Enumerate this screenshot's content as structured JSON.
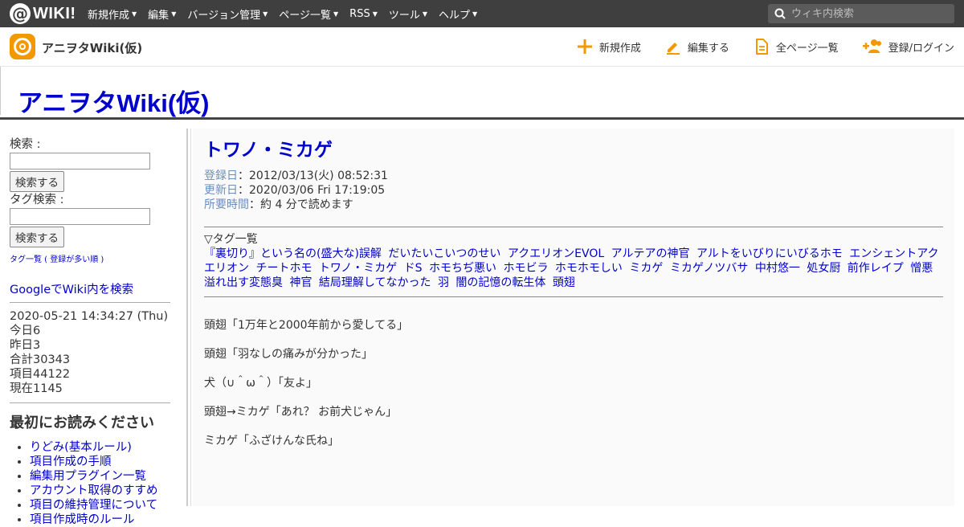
{
  "topbar": {
    "logo_at": "@",
    "logo_text": "WIKI!",
    "menu": [
      {
        "label": "新規作成"
      },
      {
        "label": "編集"
      },
      {
        "label": "バージョン管理"
      },
      {
        "label": "ページ一覧"
      },
      {
        "label": "RSS"
      },
      {
        "label": "ツール"
      },
      {
        "label": "ヘルプ"
      }
    ],
    "search_placeholder": "ウィキ内検索"
  },
  "header": {
    "site_name": "アニヲタWiki(仮)",
    "actions": [
      {
        "label": "新規作成",
        "icon": "plus-icon"
      },
      {
        "label": "編集する",
        "icon": "pencil-icon"
      },
      {
        "label": "全ページ一覧",
        "icon": "document-icon"
      },
      {
        "label": "登録/ログイン",
        "icon": "add-user-icon"
      }
    ]
  },
  "banner": {
    "title": "アニヲタWiki(仮)"
  },
  "sidebar": {
    "search_label": "検索 :",
    "search_button": "検索する",
    "tag_search_label": "タグ検索 :",
    "tag_search_button": "検索する",
    "tag_list_link": "タグ一覧 ( 登録が多い順 )",
    "google_link": "GoogleでWiki内を検索",
    "stats": {
      "datetime": "2020-05-21 14:34:27 (Thu)",
      "today": "今日6",
      "yesterday": "昨日3",
      "total": "合計30343",
      "items": "項目44122",
      "now": "現在1145"
    },
    "read_first_heading": "最初にお読みください",
    "read_first_items": [
      "りどみ(基本ルール)",
      "項目作成の手順",
      "編集用プラグイン一覧",
      "アカウント取得のすすめ",
      "項目の維持管理について",
      "項目作成時のルール"
    ]
  },
  "page": {
    "title": "トワノ・ミカゲ",
    "registered_label": "登録日",
    "registered_value": "：2012/03/13(火) 08:52:31",
    "updated_label": "更新日",
    "updated_value": "：2020/03/06 Fri 17:19:05",
    "reading_label": "所要時間",
    "reading_value": "：約 4 分で読めます",
    "tags_heading": "▽タグ一覧",
    "tags": [
      "『裏切り』という名の(盛大な)誤解",
      "だいたいこいつのせい",
      "アクエリオンEVOL",
      "アルテアの神官",
      "アルトをいびりにいびるホモ",
      "エンシェントアクエリオン",
      "チートホモ",
      "トワノ・ミカゲ",
      "ドS",
      "ホモちぢ悪い",
      "ホモビラ",
      "ホモホモしい",
      "ミカゲ",
      "ミカゲノツバサ",
      "中村悠一",
      "処女厨",
      "前作レイプ",
      "憎悪",
      "溢れ出す変態臭",
      "神官",
      "結局理解してなかった",
      "羽",
      "闇の記憶の転生体",
      "頭翅"
    ],
    "body": [
      "頭翅「1万年と2000年前から愛してる」",
      "頭翅「羽なしの痛みが分かった」",
      "犬（∪＾ω＾）「友よ」",
      "頭翅→ミカゲ「あれ？ お前犬じゃん」",
      "ミカゲ「ふざけんな氏ね」"
    ]
  },
  "colors": {
    "topbar": "#3f3f3f",
    "brand_orange": "#f39800",
    "link": "#0000cc",
    "meta_label": "#6b8ebd"
  }
}
